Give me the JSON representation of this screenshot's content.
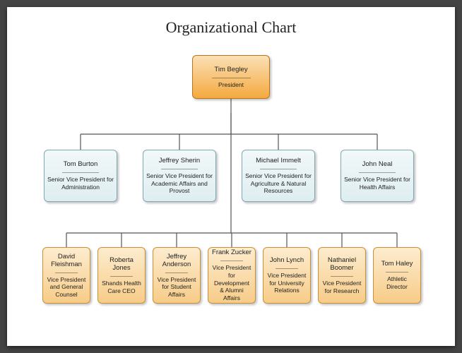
{
  "title": "Organizational Chart",
  "top": {
    "name": "Tim Begley",
    "role": "President"
  },
  "svps": [
    {
      "name": "Tom Burton",
      "role": "Senior Vice President for Administration"
    },
    {
      "name": "Jeffrey Sherin",
      "role": "Senior Vice President for Academic Affairs and Provost"
    },
    {
      "name": "Michael Immelt",
      "role": "Senior Vice President for Agriculture & Natural Resources"
    },
    {
      "name": "John Neal",
      "role": "Senior Vice President for Health Affairs"
    }
  ],
  "vps": [
    {
      "name": "David Fleishman",
      "role": "Vice President and General Counsel"
    },
    {
      "name": "Roberta Jones",
      "role": "Shands Health Care CEO"
    },
    {
      "name": "Jeffrey Anderson",
      "role": "Vice President for Student Affairs"
    },
    {
      "name": "Frank Zucker",
      "role": "Vice President for Development & Alumni Affairs"
    },
    {
      "name": "John Lynch",
      "role": "Vice President for University Relations"
    },
    {
      "name": "Nathaniel Boomer",
      "role": "Vice President for Research"
    },
    {
      "name": "Tom Haley",
      "role": "Athletic Director"
    }
  ]
}
